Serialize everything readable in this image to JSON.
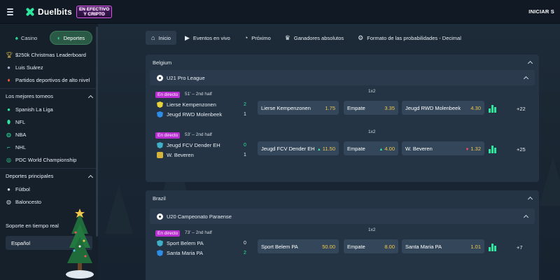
{
  "header": {
    "brand": "Duelbits",
    "promo_line1": "EN EFECTIVO",
    "promo_line2": "Y CRIPTO",
    "login": "INICIAR S"
  },
  "sidebar": {
    "toggles": [
      {
        "label": "Casino",
        "icon": "casino-icon",
        "active": false
      },
      {
        "label": "Deportes",
        "icon": "sports-icon",
        "active": true
      }
    ],
    "promo_items": [
      {
        "label": "$250k Christmas Leaderboard",
        "icon": "trophy-icon"
      },
      {
        "label": "Luis Suárez",
        "icon": "player-icon"
      },
      {
        "label": "Partidos deportivos de alto nivel",
        "icon": "fire-icon"
      }
    ],
    "top_tournaments": {
      "title": "Los mejores torneos",
      "items": [
        {
          "label": "Spanish La Liga",
          "icon": "soccer-icon"
        },
        {
          "label": "NFL",
          "icon": "football-icon"
        },
        {
          "label": "NBA",
          "icon": "basketball-icon"
        },
        {
          "label": "NHL",
          "icon": "hockey-icon"
        },
        {
          "label": "PDC World Championship",
          "icon": "darts-icon"
        }
      ]
    },
    "main_sports": {
      "title": "Deportes principales",
      "items": [
        {
          "label": "Fútbol",
          "icon": "soccer-icon"
        },
        {
          "label": "Baloncesto",
          "icon": "basketball-icon"
        }
      ]
    },
    "support": "Soporte en tiempo real",
    "language": "Español"
  },
  "tabs": [
    {
      "label": "Inicio",
      "icon": "home-icon",
      "active": true
    },
    {
      "label": "Eventos en vivo",
      "icon": "video-icon"
    },
    {
      "label": "Próximo",
      "icon": "stopwatch-icon"
    },
    {
      "label": "Ganadores absolutos",
      "icon": "trophy-icon"
    },
    {
      "label": "Formato de las probabilidades - Decimal",
      "icon": "gear-icon"
    }
  ],
  "sections": [
    {
      "country": "Belgium",
      "league": "U21 Pro League",
      "matches": [
        {
          "live": "En directo",
          "clock": "51' – 2nd half",
          "market": "1x2",
          "home": {
            "name": "Lierse Kempenzonen",
            "score": "2"
          },
          "away": {
            "name": "Jeugd RWD Molenbeek",
            "score": "1"
          },
          "odds": [
            {
              "label": "Lierse Kempenzonen",
              "value": "1.75",
              "trend": ""
            },
            {
              "label": "Empate",
              "value": "3.35",
              "trend": ""
            },
            {
              "label": "Jeugd RWD Molenbeek",
              "value": "4.30",
              "trend": ""
            }
          ],
          "more": "+22"
        },
        {
          "live": "En directo",
          "clock": "53' – 2nd half",
          "market": "1x2",
          "home": {
            "name": "Jeugd FCV Dender EH",
            "score": "0"
          },
          "away": {
            "name": "W. Beveren",
            "score": "1"
          },
          "odds": [
            {
              "label": "Jeugd FCV Dender EH",
              "value": "11.50",
              "trend": "up"
            },
            {
              "label": "Empate",
              "value": "4.00",
              "trend": "up"
            },
            {
              "label": "W. Beveren",
              "value": "1.32",
              "trend": "down"
            }
          ],
          "more": "+25"
        }
      ]
    },
    {
      "country": "Brazil",
      "league": "U20 Campeonato Paraense",
      "matches": [
        {
          "live": "En directo",
          "clock": "73' – 2nd half",
          "market": "1x2",
          "home": {
            "name": "Sport Belem PA",
            "score": "0"
          },
          "away": {
            "name": "Santa Maria PA",
            "score": "2"
          },
          "odds": [
            {
              "label": "Sport Belem PA",
              "value": "50.00",
              "trend": ""
            },
            {
              "label": "Empate",
              "value": "8.00",
              "trend": ""
            },
            {
              "label": "Santa Maria PA",
              "value": "1.01",
              "trend": ""
            }
          ],
          "more": "+7"
        }
      ]
    }
  ],
  "colors": {
    "accent": "#2ee59d",
    "odds_value": "#f2c94c",
    "live_badge": "#b92fd4",
    "trend_up": "#2ee59d",
    "trend_down": "#ff4d5e"
  }
}
